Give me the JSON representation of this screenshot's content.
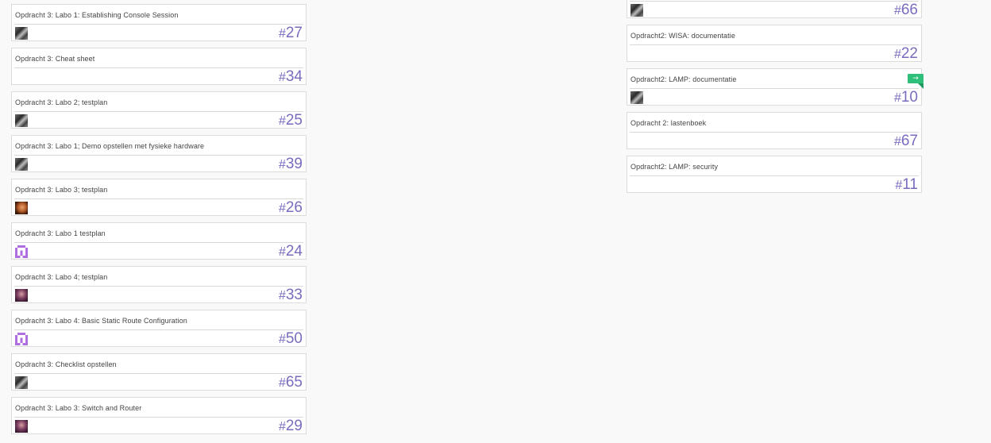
{
  "colors": {
    "card_number": "#7b6bbf",
    "badge": "#2ec07a",
    "background": "#f9f9f9",
    "card_border": "#dcdcdc"
  },
  "left_column": [
    {
      "title": "Opdracht 3: Labo 1: Establishing Console Session",
      "number": "27",
      "avatar": "gray-avatar"
    },
    {
      "title": "Opdracht 3: Cheat sheet",
      "number": "34",
      "avatar": ""
    },
    {
      "title": "Opdracht 3: Labo 2; testplan",
      "number": "25",
      "avatar": "gray-avatar"
    },
    {
      "title": "Opdracht 3: Labo 1; Demo opstellen met fysieke hardware",
      "number": "39",
      "avatar": "gray-avatar"
    },
    {
      "title": "Opdracht 3: Labo 3; testplan",
      "number": "26",
      "avatar": "face-avatar"
    },
    {
      "title": "Opdracht 3: Labo 1 testplan",
      "number": "24",
      "avatar": "purple-identicon"
    },
    {
      "title": "Opdracht 3: Labo 4; testplan",
      "number": "33",
      "avatar": "person-avatar"
    },
    {
      "title": "Opdracht 3: Labo 4: Basic Static Route Configuration",
      "number": "50",
      "avatar": "purple-identicon"
    },
    {
      "title": "Opdracht 3: Checklist opstellen",
      "number": "65",
      "avatar": "gray-avatar"
    },
    {
      "title": "Opdracht 3: Labo 3: Switch and Router",
      "number": "29",
      "avatar": "person-avatar"
    }
  ],
  "right_column": [
    {
      "title": "",
      "number": "66",
      "avatar": "gray-avatar"
    },
    {
      "title": "Opdracht2: WISA: documentatie",
      "number": "22",
      "avatar": ""
    },
    {
      "title": "Opdracht2: LAMP: documentatie",
      "number": "10",
      "avatar": "gray-avatar",
      "badge": "→"
    },
    {
      "title": "Opdracht 2: lastenboek",
      "number": "67",
      "avatar": ""
    },
    {
      "title": "Opdracht2: LAMP: security",
      "number": "11",
      "avatar": ""
    }
  ]
}
